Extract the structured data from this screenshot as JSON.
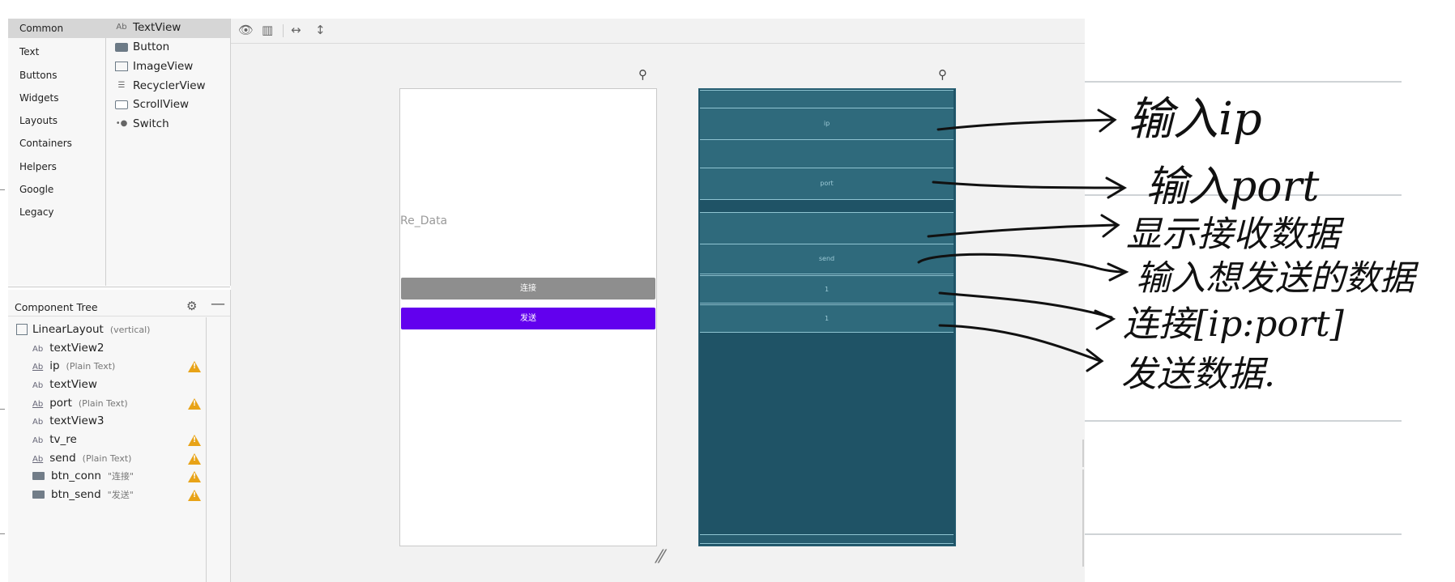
{
  "palette": {
    "categories": [
      "Common",
      "Text",
      "Buttons",
      "Widgets",
      "Layouts",
      "Containers",
      "Helpers",
      "Google",
      "Legacy"
    ],
    "selected_category": "Common",
    "items": [
      {
        "icon": "textview-icon",
        "label": "TextView"
      },
      {
        "icon": "button-icon",
        "label": "Button"
      },
      {
        "icon": "imageview-icon",
        "label": "ImageView"
      },
      {
        "icon": "recyclerview-icon",
        "label": "RecyclerView"
      },
      {
        "icon": "scrollview-icon",
        "label": "ScrollView"
      },
      {
        "icon": "switch-icon",
        "label": "Switch"
      }
    ]
  },
  "component_tree": {
    "title": "Component Tree",
    "root": {
      "name": "LinearLayout",
      "hint": "(vertical)"
    },
    "nodes": [
      {
        "name": "textView2",
        "hint": "",
        "type": "text",
        "warning": false
      },
      {
        "name": "ip",
        "hint": "(Plain Text)",
        "type": "edit",
        "warning": true
      },
      {
        "name": "textView",
        "hint": "",
        "type": "text",
        "warning": false
      },
      {
        "name": "port",
        "hint": "(Plain Text)",
        "type": "edit",
        "warning": true
      },
      {
        "name": "textView3",
        "hint": "",
        "type": "text",
        "warning": false
      },
      {
        "name": "tv_re",
        "hint": "",
        "type": "text",
        "warning": true
      },
      {
        "name": "send",
        "hint": "(Plain Text)",
        "type": "edit",
        "warning": true
      },
      {
        "name": "btn_conn",
        "hint": "\"连接\"",
        "type": "button",
        "warning": true
      },
      {
        "name": "btn_send",
        "hint": "\"发送\"",
        "type": "button",
        "warning": true
      }
    ],
    "warning_color": "#e8a317"
  },
  "preview": {
    "redata_text": "Re_Data",
    "btn_conn_label": "连接",
    "btn_send_label": "发送",
    "btn_conn_color": "#8e8e8e",
    "btn_send_color": "#6200ee"
  },
  "blueprint": {
    "ip_hint": "ip",
    "port_hint": "port",
    "send_hint": "send",
    "conn_text": "1",
    "send_btn_text": "1"
  },
  "annotations": [
    "输入ip",
    "输入port",
    "显示接收数据",
    "输入想发送的数据",
    "连接[ip:port]",
    "发送数据."
  ]
}
